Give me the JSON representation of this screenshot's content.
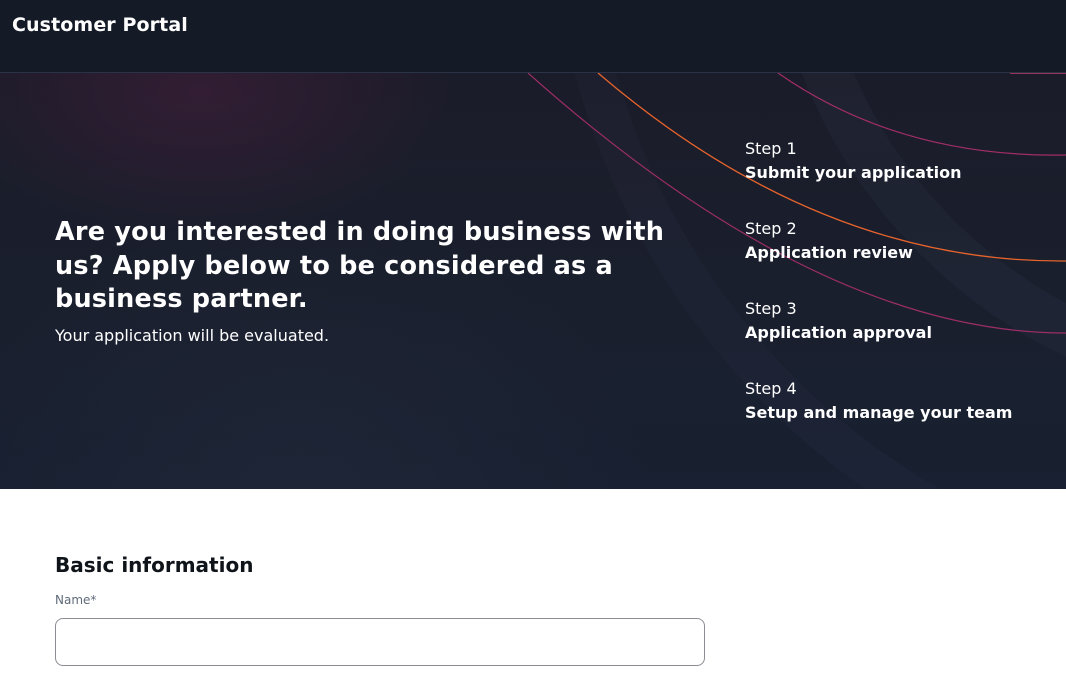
{
  "header": {
    "title": "Customer Portal"
  },
  "hero": {
    "heading": "Are you interested in doing business with us? Apply below to be considered as a business partner.",
    "subheading": "Your application will be evaluated."
  },
  "steps": [
    {
      "number": "Step 1",
      "title": "Submit your application"
    },
    {
      "number": "Step 2",
      "title": "Application review"
    },
    {
      "number": "Step 3",
      "title": "Application approval"
    },
    {
      "number": "Step 4",
      "title": "Setup and manage your team"
    }
  ],
  "form": {
    "section_title": "Basic information",
    "fields": {
      "name": {
        "label": "Name*",
        "value": "",
        "placeholder": ""
      }
    }
  },
  "colors": {
    "header_bg": "#141b27",
    "hero_bg": "#1a1f2d",
    "arc_orange": "#e8642c",
    "arc_magenta": "#b0306e",
    "text_light": "#ffffff",
    "text_dark": "#0f141a"
  }
}
